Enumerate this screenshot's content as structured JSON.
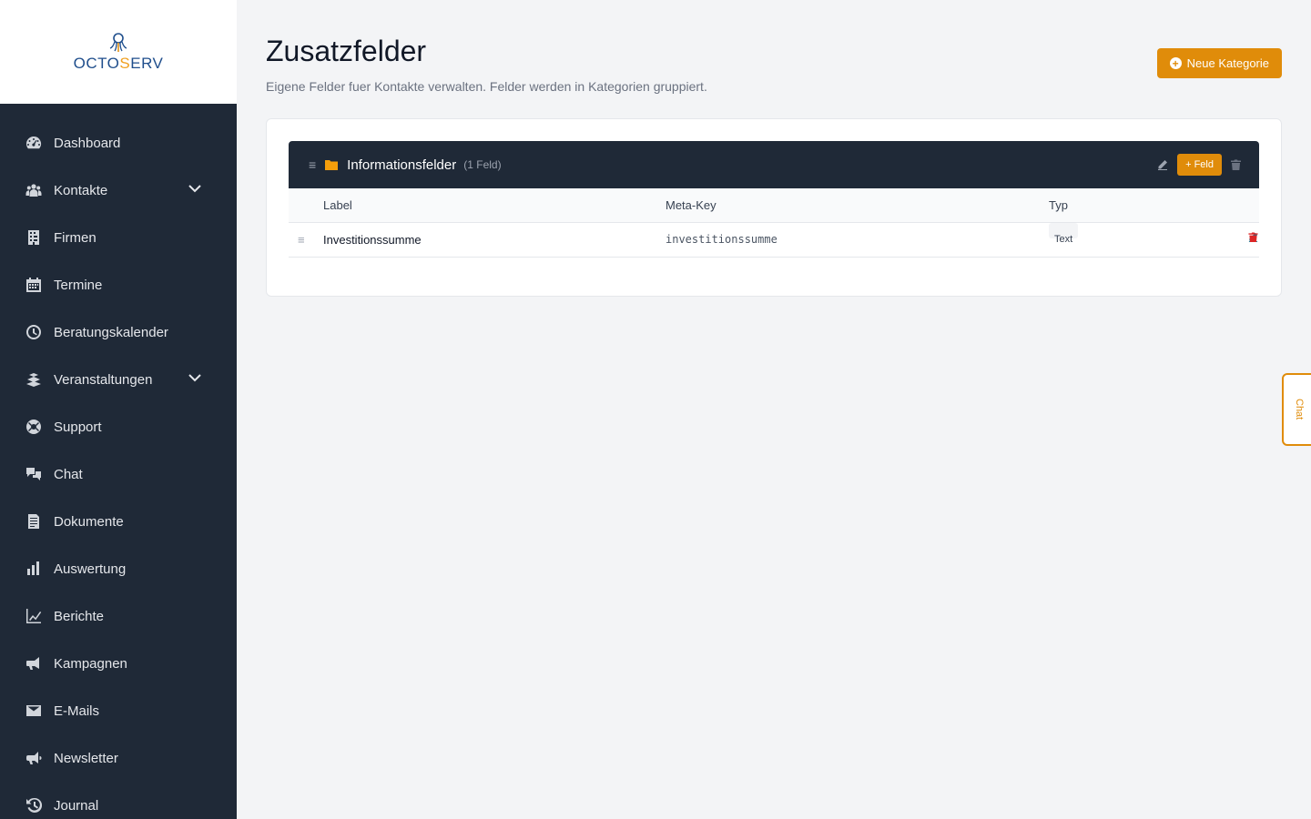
{
  "brand": {
    "logo_text_pre": "OCTO",
    "logo_text_s": "S",
    "logo_text_post": "ERV",
    "accent": "#e08c0a",
    "sidebar_bg": "#1f2937"
  },
  "sidebar": {
    "items": [
      {
        "label": "Dashboard",
        "icon": "dashboard-icon",
        "expandable": false
      },
      {
        "label": "Kontakte",
        "icon": "users-icon",
        "expandable": true
      },
      {
        "label": "Firmen",
        "icon": "building-icon",
        "expandable": false
      },
      {
        "label": "Termine",
        "icon": "calendar-icon",
        "expandable": false
      },
      {
        "label": "Beratungskalender",
        "icon": "clock-icon",
        "expandable": false
      },
      {
        "label": "Veranstaltungen",
        "icon": "events-icon",
        "expandable": true
      },
      {
        "label": "Support",
        "icon": "lifering-icon",
        "expandable": false
      },
      {
        "label": "Chat",
        "icon": "comments-icon",
        "expandable": false
      },
      {
        "label": "Dokumente",
        "icon": "document-icon",
        "expandable": false
      },
      {
        "label": "Auswertung",
        "icon": "bar-chart-icon",
        "expandable": false
      },
      {
        "label": "Berichte",
        "icon": "line-chart-icon",
        "expandable": false
      },
      {
        "label": "Kampagnen",
        "icon": "megaphone-icon",
        "expandable": false
      },
      {
        "label": "E-Mails",
        "icon": "envelope-icon",
        "expandable": false
      },
      {
        "label": "Newsletter",
        "icon": "bullhorn-icon",
        "expandable": false
      },
      {
        "label": "Journal",
        "icon": "history-icon",
        "expandable": false
      }
    ]
  },
  "header": {
    "title": "Zusatzfelder",
    "subtitle": "Eigene Felder fuer Kontakte verwalten. Felder werden in Kategorien gruppiert.",
    "new_category_label": "Neue Kategorie"
  },
  "category": {
    "name": "Informationsfelder",
    "count_text": "(1 Feld)",
    "add_field_label": "+ Feld",
    "columns": {
      "label": "Label",
      "meta_key": "Meta-Key",
      "type": "Typ"
    },
    "fields": [
      {
        "label": "Investitionssumme",
        "meta_key": "investitionssumme",
        "type": "Text"
      }
    ]
  },
  "chat_tab": {
    "label": "Chat"
  }
}
